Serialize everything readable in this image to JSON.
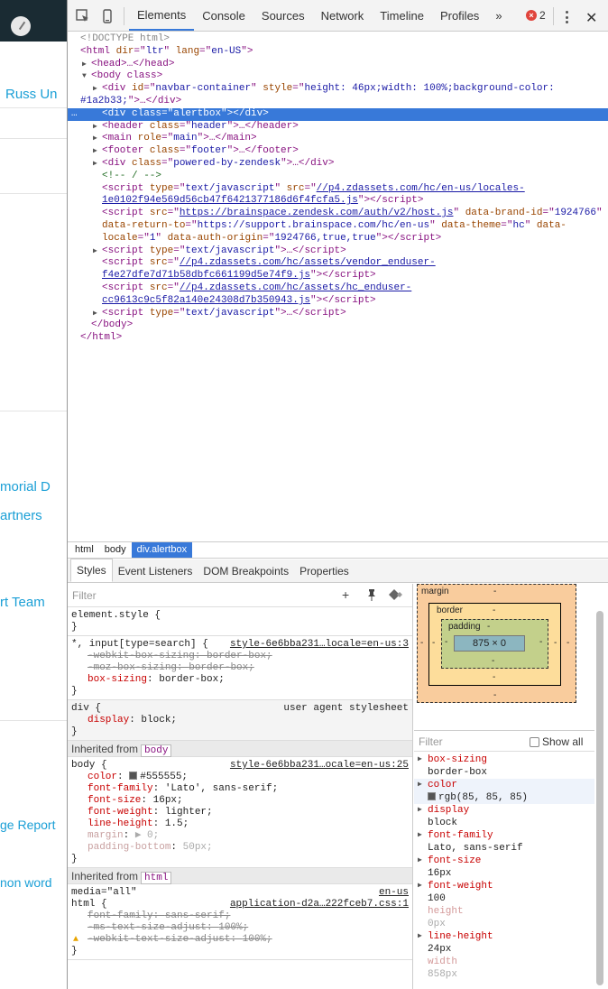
{
  "left_page": {
    "items": [
      "Russ Un",
      "morial D",
      "artners",
      "rt Team",
      "ge Report",
      "non word"
    ]
  },
  "toolbar": {
    "tabs": [
      "Elements",
      "Console",
      "Sources",
      "Network",
      "Timeline",
      "Profiles"
    ],
    "more": "»",
    "error_count": "2",
    "close": "✕"
  },
  "tree": {
    "doctype": "<!DOCTYPE html>",
    "html_open": [
      "<html",
      " dir",
      "=\"",
      "ltr",
      "\" ",
      "lang",
      "=\"",
      "en-US",
      "\">"
    ],
    "head": "<head>…</head>",
    "body_open": "<body class>",
    "navbar": {
      "open": "<div",
      "id_attr": "id",
      "id_val": "navbar-container",
      "style_attr": "style",
      "style_val": "height: 46px;width: 100%;background-color:",
      "style_val2": "#1a2b33;",
      "close": "\">…</div>"
    },
    "alertbox": {
      "open": "<div",
      "class_attr": "class",
      "class_val": "alertbox",
      "close": "</div>",
      "dots": "…"
    },
    "header": {
      "class_val": "header"
    },
    "main": {
      "role_val": "main"
    },
    "footer": {
      "class_val": "footer"
    },
    "powered": {
      "class_val": "powered-by-zendesk"
    },
    "comment": "<!-- / -->",
    "script1": {
      "type_val": "text/javascript",
      "src1": "//p4.zdassets.com/hc/en-us/locales-",
      "src2": "1e0102f94e569d56cb47f6421377186d6f4fcfa5.js"
    },
    "script2": {
      "src": "https://brainspace.zendesk.com/auth/v2/host.js",
      "brand": "1924766",
      "return_to": "https://support.brainspace.com/hc/en-us",
      "theme": "hc",
      "locale": "1",
      "auth_origin": "1924766,true,true"
    },
    "script3": {
      "type_val": "text/javascript"
    },
    "script4": {
      "src1": "//p4.zdassets.com/hc/assets/vendor_enduser-",
      "src2": "f4e27dfe7d71b58dbfc661199d5e74f9.js"
    },
    "script5": {
      "src1": "//p4.zdassets.com/hc/assets/hc_enduser-",
      "src2": "cc9613c9c5f82a140e24308d7b350943.js"
    },
    "script6": {
      "type_val": "text/javascript"
    },
    "body_close": "</body>",
    "html_close": "</html>"
  },
  "breadcrumbs": [
    "html",
    "body",
    "div.alertbox"
  ],
  "subtabs": [
    "Styles",
    "Event Listeners",
    "DOM Breakpoints",
    "Properties"
  ],
  "styles": {
    "filter_placeholder": "Filter",
    "element_style": "element.style {",
    "rule1": {
      "selector": "*, input[type=search] {",
      "source": "style-6e6bba231…locale=en-us:3",
      "props": [
        {
          "name": "-webkit-box-sizing",
          "value": "border-box;"
        },
        {
          "name": "-moz-box-sizing",
          "value": "border-box;"
        },
        {
          "name": "box-sizing",
          "value": "border-box;"
        }
      ]
    },
    "rule2": {
      "selector": "div {",
      "source": "user agent stylesheet",
      "props": [
        {
          "name": "display",
          "value": "block;"
        }
      ]
    },
    "inherited_body": "Inherited from",
    "inherited_body_tag": "body",
    "rule3": {
      "selector": "body {",
      "source": "style-6e6bba231…ocale=en-us:25",
      "props": [
        {
          "name": "color",
          "value": "#555555;"
        },
        {
          "name": "font-family",
          "value": "'Lato', sans-serif;"
        },
        {
          "name": "font-size",
          "value": "16px;"
        },
        {
          "name": "font-weight",
          "value": "lighter;"
        },
        {
          "name": "line-height",
          "value": "1.5;"
        },
        {
          "name": "margin",
          "value": "▶ 0;"
        },
        {
          "name": "padding-bottom",
          "value": "50px;"
        }
      ]
    },
    "inherited_html_tag": "html",
    "rule4": {
      "media": "media=\"all\"",
      "media_src": "en-us",
      "selector": "html {",
      "source": "application-d2a…222fceb7.css:1",
      "props": [
        {
          "name": "font-family",
          "value": "sans-serif;"
        },
        {
          "name": "-ms-text-size-adjust",
          "value": "100%;"
        },
        {
          "name": "-webkit-text-size-adjust",
          "value": "100%;"
        }
      ]
    },
    "close_brace": "}"
  },
  "boxmodel": {
    "margin": "margin",
    "border": "border",
    "padding": "padding",
    "dash": "-",
    "content": "875 × 0"
  },
  "computed": {
    "filter_placeholder": "Filter",
    "show_all": "Show all",
    "items": [
      {
        "name": "box-sizing",
        "value": "border-box"
      },
      {
        "name": "color",
        "value": "rgb(85, 85, 85)"
      },
      {
        "name": "display",
        "value": "block"
      },
      {
        "name": "font-family",
        "value": "Lato, sans-serif"
      },
      {
        "name": "font-size",
        "value": "16px"
      },
      {
        "name": "font-weight",
        "value": "100"
      },
      {
        "name": "height",
        "value": "0px"
      },
      {
        "name": "line-height",
        "value": "24px"
      },
      {
        "name": "width",
        "value": "858px"
      }
    ]
  },
  "colors": {
    "accent": "#3879d9",
    "link": "#1a9fd6",
    "navbar": "#1a2b33",
    "error": "#e0443c"
  }
}
